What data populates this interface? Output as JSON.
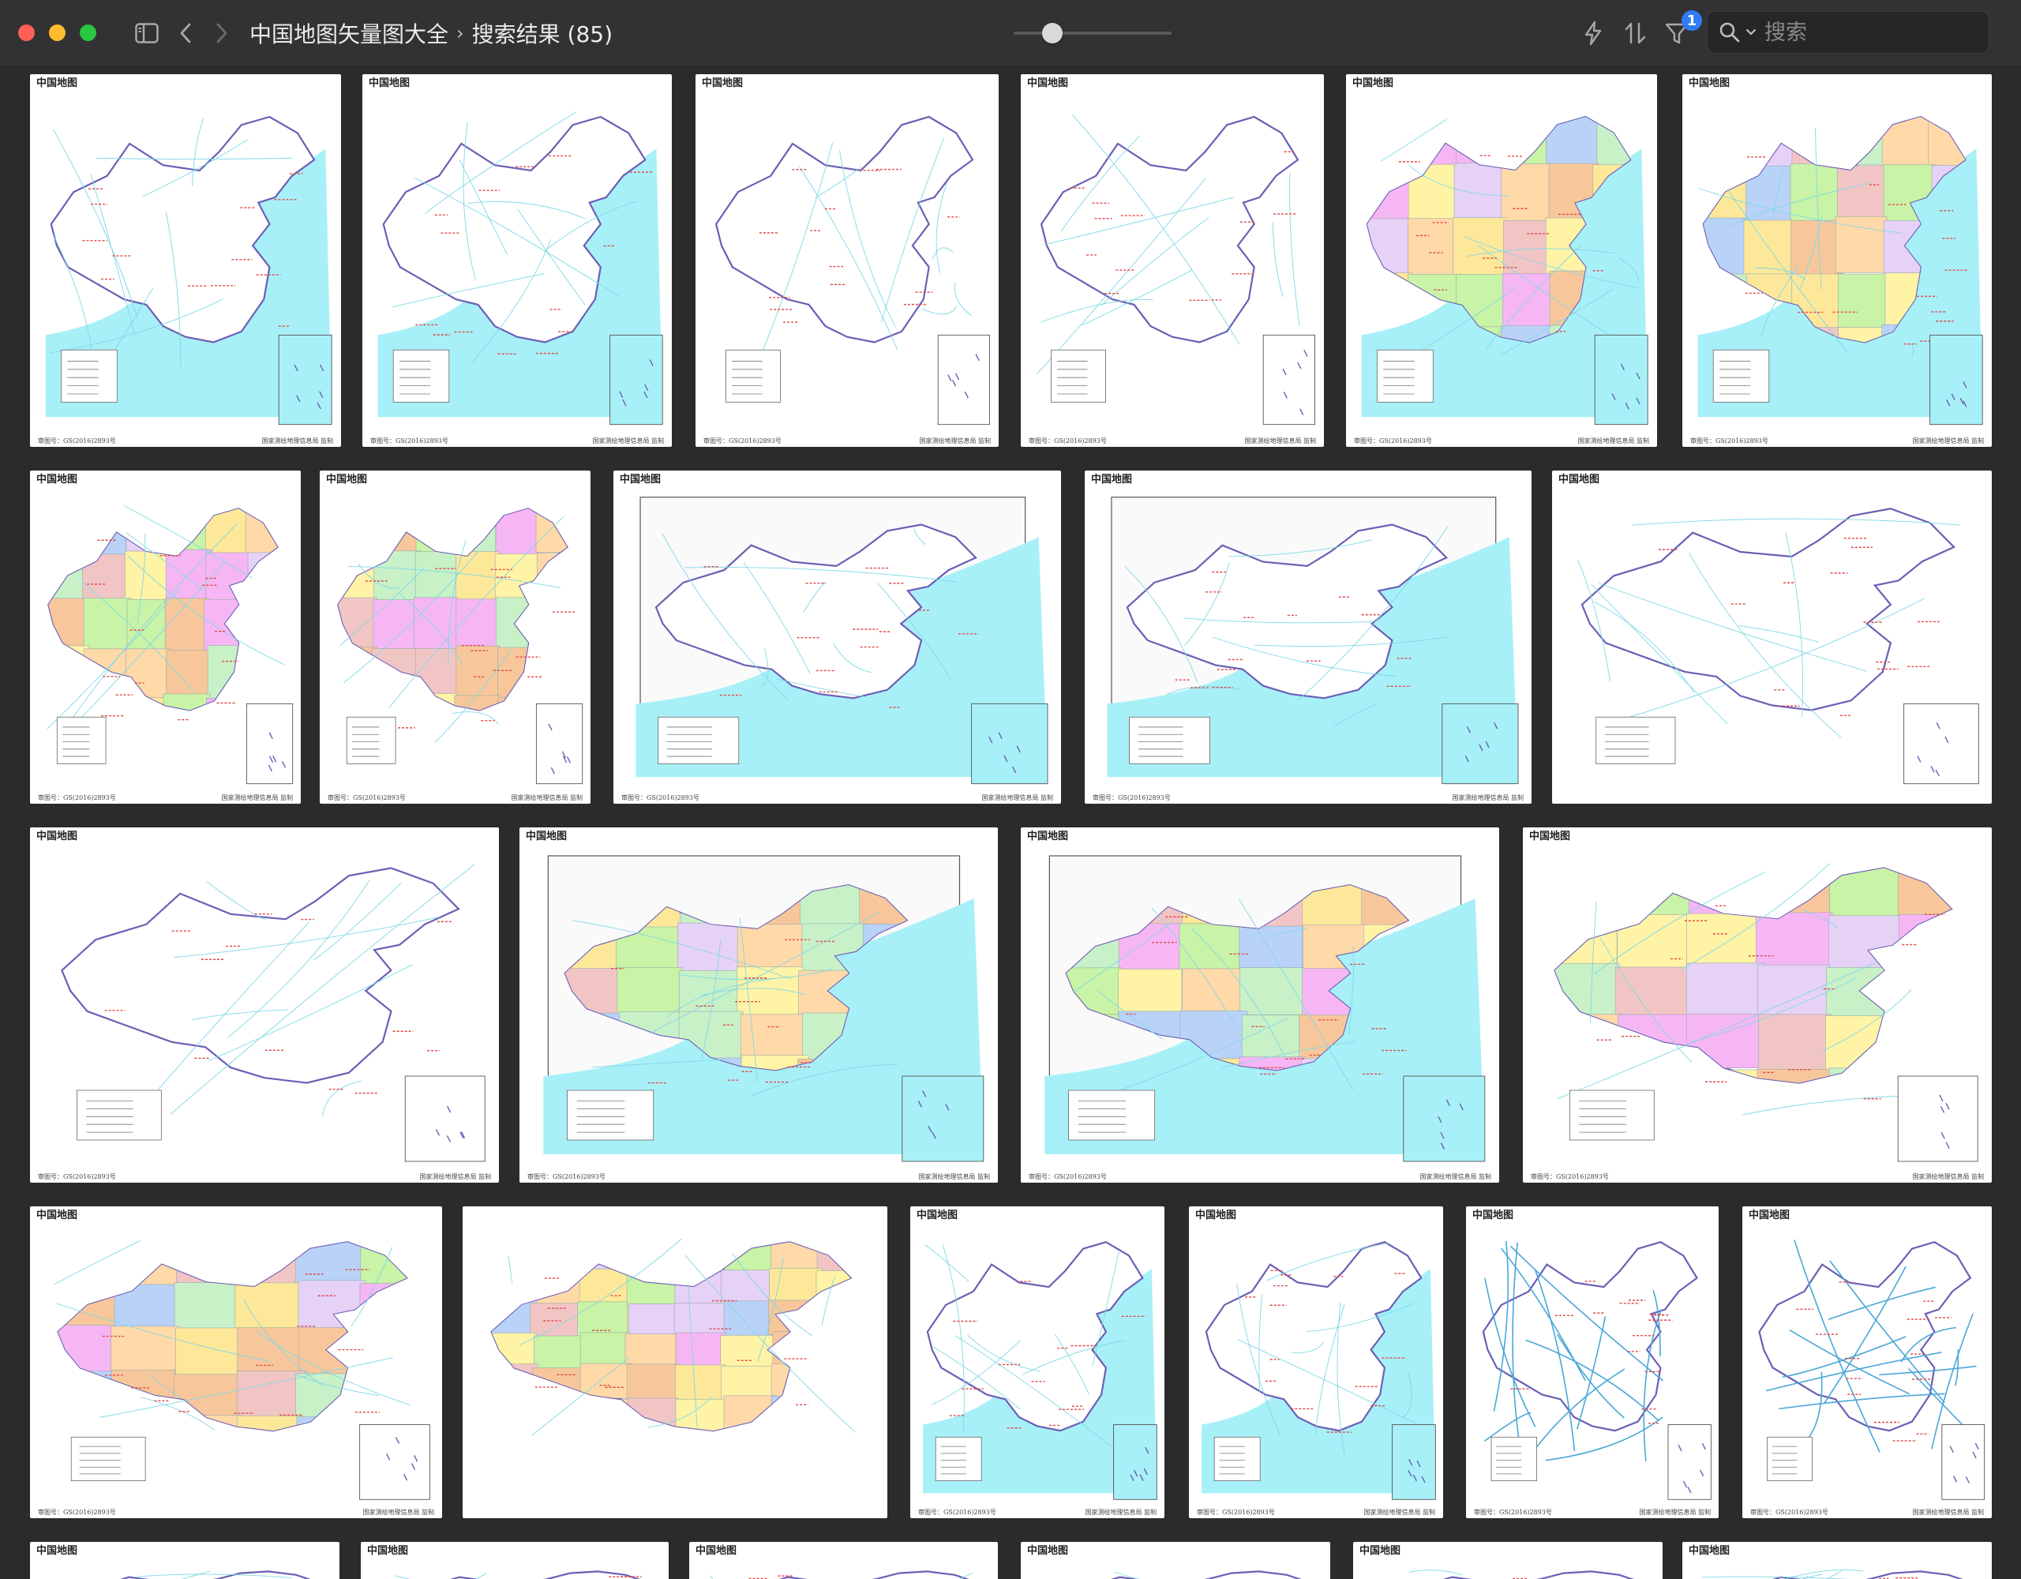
{
  "window": {
    "breadcrumb": [
      "中国地图矢量图大全",
      "搜索结果 (85)"
    ],
    "filter_badge": "1",
    "search_placeholder": "搜索"
  },
  "icons": {
    "sidebar_toggle": "sidebar-icon",
    "back": "chevron-left-icon",
    "forward": "chevron-right-icon",
    "quick_action": "lightning-icon",
    "sort": "sort-icon",
    "filter": "filter-icon",
    "search": "magnifier-icon"
  },
  "thumb_caption": "中国地图",
  "thumb_footer_left": "审图号：GS(2016)2893号",
  "thumb_footer_right": "国家测绘地理信息局 监制",
  "thumbnails": [
    {
      "style": "outline-sea",
      "caption": true,
      "footer": true
    },
    {
      "style": "outline-sea",
      "caption": true,
      "footer": true
    },
    {
      "style": "outline",
      "caption": true,
      "footer": true
    },
    {
      "style": "outline",
      "caption": true,
      "footer": true
    },
    {
      "style": "color-sea",
      "caption": true,
      "footer": true
    },
    {
      "style": "color-sea",
      "caption": true,
      "footer": true
    },
    {
      "style": "color",
      "caption": true,
      "footer": true
    },
    {
      "style": "color",
      "caption": true,
      "footer": true
    },
    {
      "style": "outline-frame",
      "caption": true,
      "footer": true
    },
    {
      "style": "outline-frame",
      "caption": true,
      "footer": true
    },
    {
      "style": "outline",
      "caption": true,
      "footer": false
    },
    {
      "style": "outline",
      "caption": true,
      "footer": true
    },
    {
      "style": "color-frame",
      "caption": true,
      "footer": true
    },
    {
      "style": "color-frame",
      "caption": true,
      "footer": true
    },
    {
      "style": "color",
      "caption": true,
      "footer": true
    },
    {
      "style": "color",
      "caption": true,
      "footer": true
    },
    {
      "style": "province-full",
      "caption": false,
      "footer": false
    },
    {
      "style": "outline-sea",
      "caption": true,
      "footer": true
    },
    {
      "style": "outline-sea",
      "caption": true,
      "footer": true
    },
    {
      "style": "rivers",
      "caption": true,
      "footer": true
    },
    {
      "style": "rivers",
      "caption": true,
      "footer": true
    },
    {
      "style": "partial",
      "caption": true,
      "footer": false
    },
    {
      "style": "partial",
      "caption": true,
      "footer": false
    },
    {
      "style": "partial",
      "caption": true,
      "footer": false
    },
    {
      "style": "partial",
      "caption": true,
      "footer": false
    },
    {
      "style": "partial",
      "caption": true,
      "footer": false
    },
    {
      "style": "partial",
      "caption": true,
      "footer": false
    }
  ]
}
